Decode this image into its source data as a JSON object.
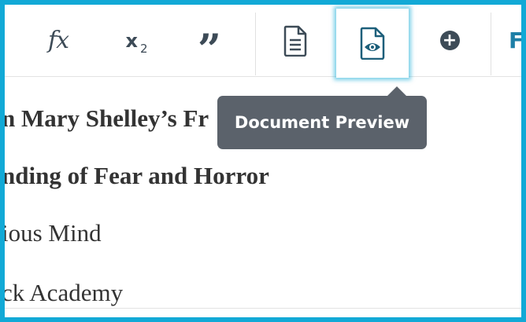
{
  "toolbar": {
    "formula_label": "fx",
    "subscript_label": "x",
    "subscript_suffix": "2",
    "quote_label": "”",
    "insert_partial_label": "F"
  },
  "tooltip": {
    "text": "Document Preview"
  },
  "document": {
    "lines": [
      "n Mary Shelley’s Fr",
      "nding of Fear and Horror",
      "ious Mind",
      "ck Academy"
    ]
  },
  "colors": {
    "frame": "#12a9d6",
    "icon": "#3d4b57",
    "accent_icon": "#1d5f7a",
    "tooltip_bg": "#5b626b"
  }
}
